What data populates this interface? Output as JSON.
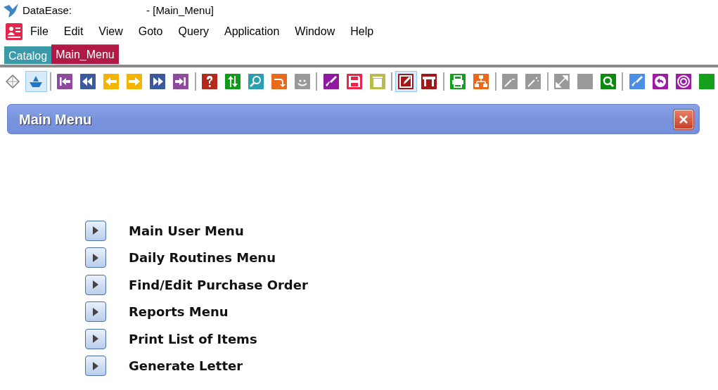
{
  "window": {
    "title": "DataEase:",
    "title_suffix": "- [Main_Menu]"
  },
  "menu": [
    "File",
    "Edit",
    "View",
    "Goto",
    "Query",
    "Application",
    "Window",
    "Help"
  ],
  "tabs": [
    {
      "label": "Catalog",
      "selected": false
    },
    {
      "label": "Main_Menu",
      "selected": true
    }
  ],
  "toolbar": [
    {
      "pressed": false
    },
    {
      "pressed": true
    },
    {
      "pressed": false
    },
    {
      "pressed": false
    },
    {
      "pressed": false
    },
    {
      "pressed": false
    },
    {
      "pressed": false
    },
    {
      "pressed": false
    },
    {
      "pressed": false
    },
    {
      "pressed": false
    },
    {
      "pressed": false
    },
    {
      "pressed": false
    },
    {
      "pressed": false
    },
    {
      "pressed": false
    },
    {
      "pressed": false
    },
    {
      "pressed": false
    },
    {
      "pressed": true
    },
    {
      "pressed": false
    },
    {
      "pressed": false
    },
    {
      "pressed": false
    },
    {
      "pressed": false
    },
    {
      "pressed": false
    },
    {
      "pressed": false
    },
    {
      "pressed": false
    },
    {
      "pressed": false
    },
    {
      "pressed": false
    },
    {
      "pressed": false
    },
    {
      "pressed": false
    },
    {
      "pressed": false
    }
  ],
  "panel": {
    "title": "Main Menu"
  },
  "menu_items": [
    "Main User Menu",
    "Daily Routines Menu",
    "Find/Edit Purchase Order",
    "Reports Menu",
    "Print List of Items",
    "Generate Letter"
  ]
}
